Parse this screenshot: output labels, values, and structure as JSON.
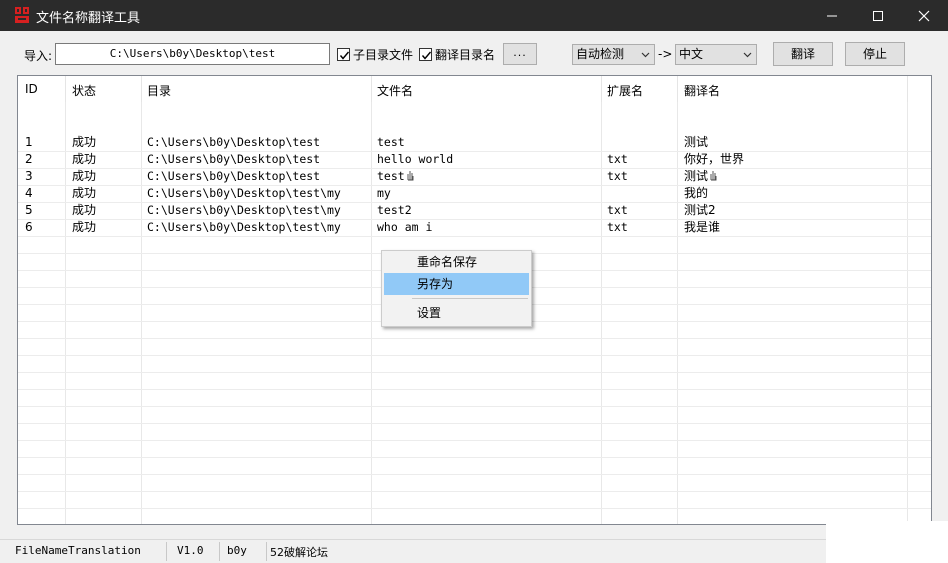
{
  "window": {
    "title": "文件名称翻译工具"
  },
  "toolbar": {
    "import_label": "导入:",
    "path_value": "C:\\Users\\b0y\\Desktop\\test",
    "include_subdirs_label": "子目录文件",
    "translate_dirnames_label": "翻译目录名",
    "browse_label": "...",
    "source_lang": "自动检测",
    "arrow": "->",
    "target_lang": "中文",
    "translate_label": "翻译",
    "stop_label": "停止"
  },
  "table": {
    "headers": [
      "ID",
      "状态",
      "目录",
      "文件名",
      "扩展名",
      "翻译名"
    ],
    "rows": [
      [
        "1",
        "成功",
        "C:\\Users\\b0y\\Desktop\\test",
        "test",
        "",
        "测试"
      ],
      [
        "2",
        "成功",
        "C:\\Users\\b0y\\Desktop\\test",
        "hello world",
        "txt",
        "你好，世界"
      ],
      [
        "3",
        "成功",
        "C:\\Users\\b0y\\Desktop\\test",
        "test",
        "txt",
        "测试"
      ],
      [
        "4",
        "成功",
        "C:\\Users\\b0y\\Desktop\\test\\my",
        "my",
        "",
        "我的"
      ],
      [
        "5",
        "成功",
        "C:\\Users\\b0y\\Desktop\\test\\my",
        "test2",
        "txt",
        "测试2"
      ],
      [
        "6",
        "成功",
        "C:\\Users\\b0y\\Desktop\\test\\my",
        "who am i",
        "txt",
        "我是谁"
      ]
    ]
  },
  "context_menu": {
    "items": [
      "重命名保存",
      "另存为",
      "设置"
    ],
    "highlighted": "另存为"
  },
  "statusbar": {
    "app_name": "FileNameTranslation",
    "version": "V1.0",
    "author": "b0y",
    "forum": "52破解论坛"
  },
  "colors": {
    "titlebar": "#2b2b2b",
    "menu_highlight": "#91c9f7",
    "app_icon": "#d62020"
  }
}
